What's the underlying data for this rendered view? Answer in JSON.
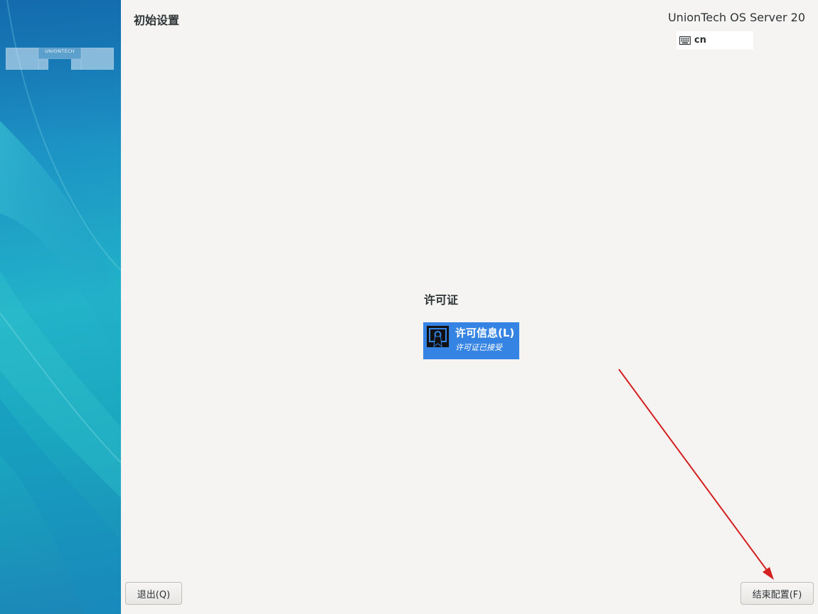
{
  "header": {
    "title": "初始设置",
    "product": "UnionTech OS Server 20",
    "keyboard_layout": "cn",
    "keyboard_icon": "keyboard-icon"
  },
  "sidebar": {
    "logo_text": "UNIONTECH"
  },
  "section": {
    "title": "许可证",
    "spokes": [
      {
        "title": "许可信息(L)",
        "status": "许可证已接受",
        "icon": "certificate-icon"
      }
    ]
  },
  "buttons": {
    "quit": "退出(Q)",
    "finish": "结束配置(F)"
  },
  "colors": {
    "accent": "#3584e4",
    "annotation_arrow": "#d42020",
    "sidebar": "#1f9fc6",
    "background": "#f5f4f2"
  }
}
